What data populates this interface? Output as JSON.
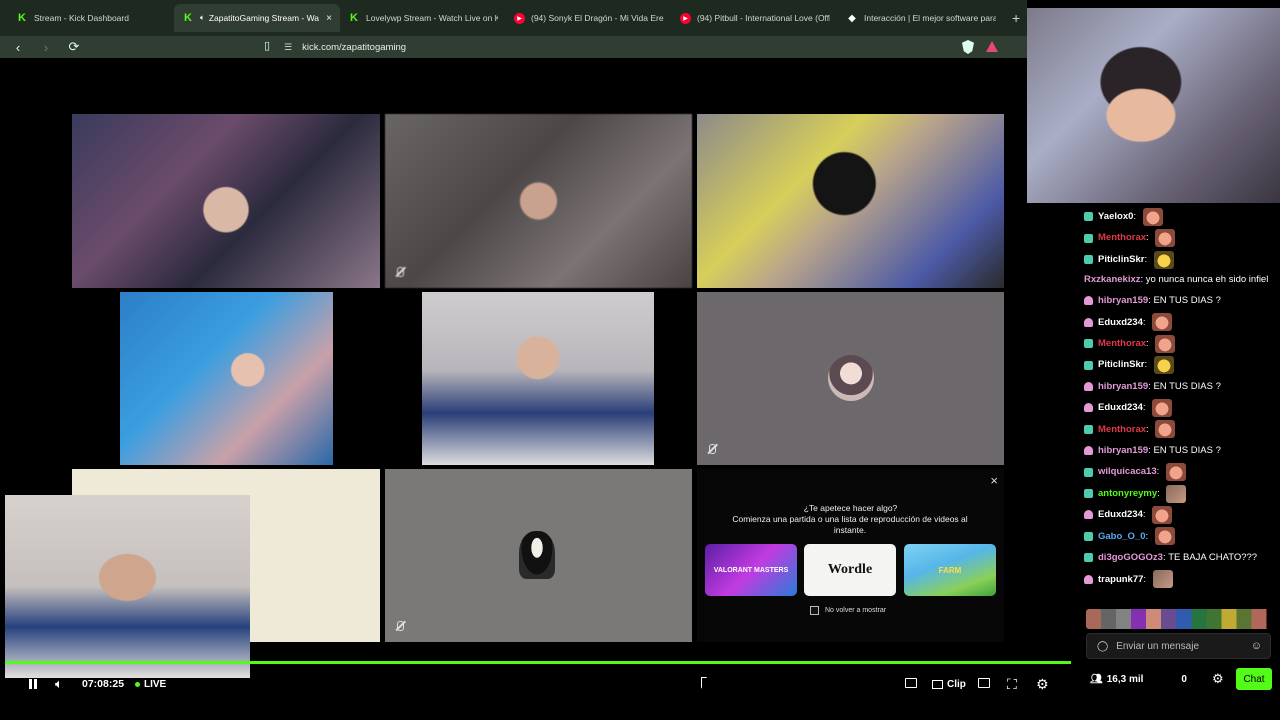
{
  "browser": {
    "tabs": [
      {
        "title": "Stream - Kick Dashboard",
        "icon": "kick-icon"
      },
      {
        "title": "ZapatitoGaming Stream - Wa",
        "icon": "kick-icon",
        "active": true
      },
      {
        "title": "Lovelywp Stream - Watch Live on Kic",
        "icon": "kick-icon"
      },
      {
        "title": "(94) Sonyk El Dragón - Mi Vida Eres T",
        "icon": "youtube-icon"
      },
      {
        "title": "(94) Pitbull - International Love (Offic",
        "icon": "youtube-icon"
      },
      {
        "title": "Interacción | El mejor software para p",
        "icon": "app-icon"
      }
    ],
    "new_tab": "+",
    "url": "kick.com/zapatitogaming"
  },
  "prompt": {
    "close": "×",
    "question": "¿Te apetece hacer algo?",
    "description": "Comienza una partida o una lista de reproducción de videos al instante.",
    "games": [
      "VALORANT MASTERS",
      "Wordle",
      "FARM"
    ],
    "dont_show": "No volver a mostrar"
  },
  "player": {
    "time": "07:08:25",
    "live_label": "LIVE",
    "clip_label": "Clip",
    "progress": 1.0
  },
  "chat": {
    "messages": [
      {
        "badge": "g",
        "user": "Yaelox0",
        "color": "#ffffff",
        "text": "",
        "emote": "face"
      },
      {
        "badge": "g",
        "user": "Menthorax",
        "color": "#e0394a",
        "text": "",
        "emote": "face"
      },
      {
        "badge": "g",
        "user": "PiticlinSkr",
        "color": "#ffffff",
        "text": "",
        "emote": "gold"
      },
      {
        "badge": "",
        "user": "Rxzkanekixz",
        "color": "#e39ad6",
        "text": "yo nunca nunca eh sido infiel",
        "emote": "",
        "multi": true
      },
      {
        "badge": "p",
        "user": "hibryan159",
        "color": "#e39ad6",
        "text": "EN TUS DIAS ?",
        "emote": ""
      },
      {
        "badge": "p",
        "user": "Eduxd234",
        "color": "#ffffff",
        "text": "",
        "emote": "face"
      },
      {
        "badge": "g",
        "user": "Menthorax",
        "color": "#e0394a",
        "text": "",
        "emote": "face"
      },
      {
        "badge": "g",
        "user": "PiticlinSkr",
        "color": "#ffffff",
        "text": "",
        "emote": "gold"
      },
      {
        "badge": "p",
        "user": "hibryan159",
        "color": "#e39ad6",
        "text": "EN TUS DIAS ?",
        "emote": ""
      },
      {
        "badge": "p",
        "user": "Eduxd234",
        "color": "#ffffff",
        "text": "",
        "emote": "face"
      },
      {
        "badge": "g",
        "user": "Menthorax",
        "color": "#e0394a",
        "text": "",
        "emote": "face"
      },
      {
        "badge": "p",
        "user": "hibryan159",
        "color": "#e39ad6",
        "text": "EN TUS DIAS ?",
        "emote": ""
      },
      {
        "badge": "g",
        "user": "wilquicaca13",
        "color": "#e39ad6",
        "text": "",
        "emote": "face"
      },
      {
        "badge": "g",
        "user": "antonyreymy",
        "color": "#53fc18",
        "text": "",
        "emote": "bw"
      },
      {
        "badge": "p",
        "user": "Eduxd234",
        "color": "#ffffff",
        "text": "",
        "emote": "face"
      },
      {
        "badge": "g",
        "user": "Gabo_O_0",
        "color": "#5aa9f0",
        "text": "",
        "emote": "face"
      },
      {
        "badge": "g",
        "user": "di3goGOGOz3",
        "color": "#e39ad6",
        "text": "TE BAJA CHATO???",
        "emote": ""
      },
      {
        "badge": "p",
        "user": "trapunk77",
        "color": "#ffffff",
        "text": "",
        "emote": "bw"
      }
    ],
    "input_placeholder": "Enviar un mensaje",
    "viewers": "16,3 mil",
    "points": "0",
    "chat_button": "Chat"
  }
}
